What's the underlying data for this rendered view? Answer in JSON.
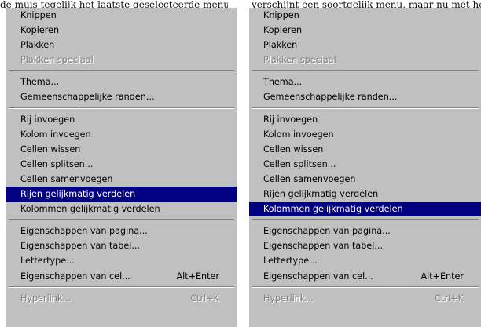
{
  "caption_left": "de muis tegelijk het laatste geselecteerde menu-item",
  "caption_right": "verschijnt een soortgelijk menu, maar nu met het nieuw",
  "menus": [
    {
      "groups": [
        [
          {
            "label": "Knippen",
            "disabled": false
          },
          {
            "label": "Kopieren",
            "disabled": false
          },
          {
            "label": "Plakken",
            "disabled": false
          },
          {
            "label": "Plakken speciaal",
            "disabled": true
          }
        ],
        [
          {
            "label": "Thema...",
            "disabled": false
          },
          {
            "label": "Gemeenschappelijke randen...",
            "disabled": false
          }
        ],
        [
          {
            "label": "Rij invoegen",
            "disabled": false
          },
          {
            "label": "Kolom invoegen",
            "disabled": false
          },
          {
            "label": "Cellen wissen",
            "disabled": false
          },
          {
            "label": "Cellen splitsen...",
            "disabled": false
          },
          {
            "label": "Cellen samenvoegen",
            "disabled": false
          },
          {
            "label": "Rijen gelijkmatig verdelen",
            "disabled": false,
            "highlighted": true
          },
          {
            "label": "Kolommen gelijkmatig verdelen",
            "disabled": false
          }
        ],
        [
          {
            "label": "Eigenschappen van pagina...",
            "disabled": false
          },
          {
            "label": "Eigenschappen van tabel...",
            "disabled": false
          },
          {
            "label": "Lettertype...",
            "disabled": false
          },
          {
            "label": "Eigenschappen van cel...",
            "shortcut": "Alt+Enter",
            "disabled": false
          }
        ],
        [
          {
            "label": "Hyperlink...",
            "shortcut": "Ctrl+K",
            "disabled": true
          }
        ]
      ]
    },
    {
      "groups": [
        [
          {
            "label": "Knippen",
            "disabled": false
          },
          {
            "label": "Kopieren",
            "disabled": false
          },
          {
            "label": "Plakken",
            "disabled": false
          },
          {
            "label": "Plakken speciaal",
            "disabled": true
          }
        ],
        [
          {
            "label": "Thema...",
            "disabled": false
          },
          {
            "label": "Gemeenschappelijke randen...",
            "disabled": false
          }
        ],
        [
          {
            "label": "Rij invoegen",
            "disabled": false
          },
          {
            "label": "Kolom invoegen",
            "disabled": false
          },
          {
            "label": "Cellen wissen",
            "disabled": false
          },
          {
            "label": "Cellen splitsen...",
            "disabled": false
          },
          {
            "label": "Cellen samenvoegen",
            "disabled": false
          },
          {
            "label": "Rijen gelijkmatig verdelen",
            "disabled": false
          },
          {
            "label": "Kolommen gelijkmatig verdelen",
            "disabled": false,
            "highlighted": true
          }
        ],
        [
          {
            "label": "Eigenschappen van pagina...",
            "disabled": false
          },
          {
            "label": "Eigenschappen van tabel...",
            "disabled": false
          },
          {
            "label": "Lettertype...",
            "disabled": false
          },
          {
            "label": "Eigenschappen van cel...",
            "shortcut": "Alt+Enter",
            "disabled": false
          }
        ],
        [
          {
            "label": "Hyperlink...",
            "shortcut": "Ctrl+K",
            "disabled": true
          }
        ]
      ]
    }
  ],
  "colors": {
    "menu_bg": "#c0c0c0",
    "highlight_bg": "#000080",
    "highlight_text": "#ffffff",
    "disabled_text": "#808080"
  }
}
